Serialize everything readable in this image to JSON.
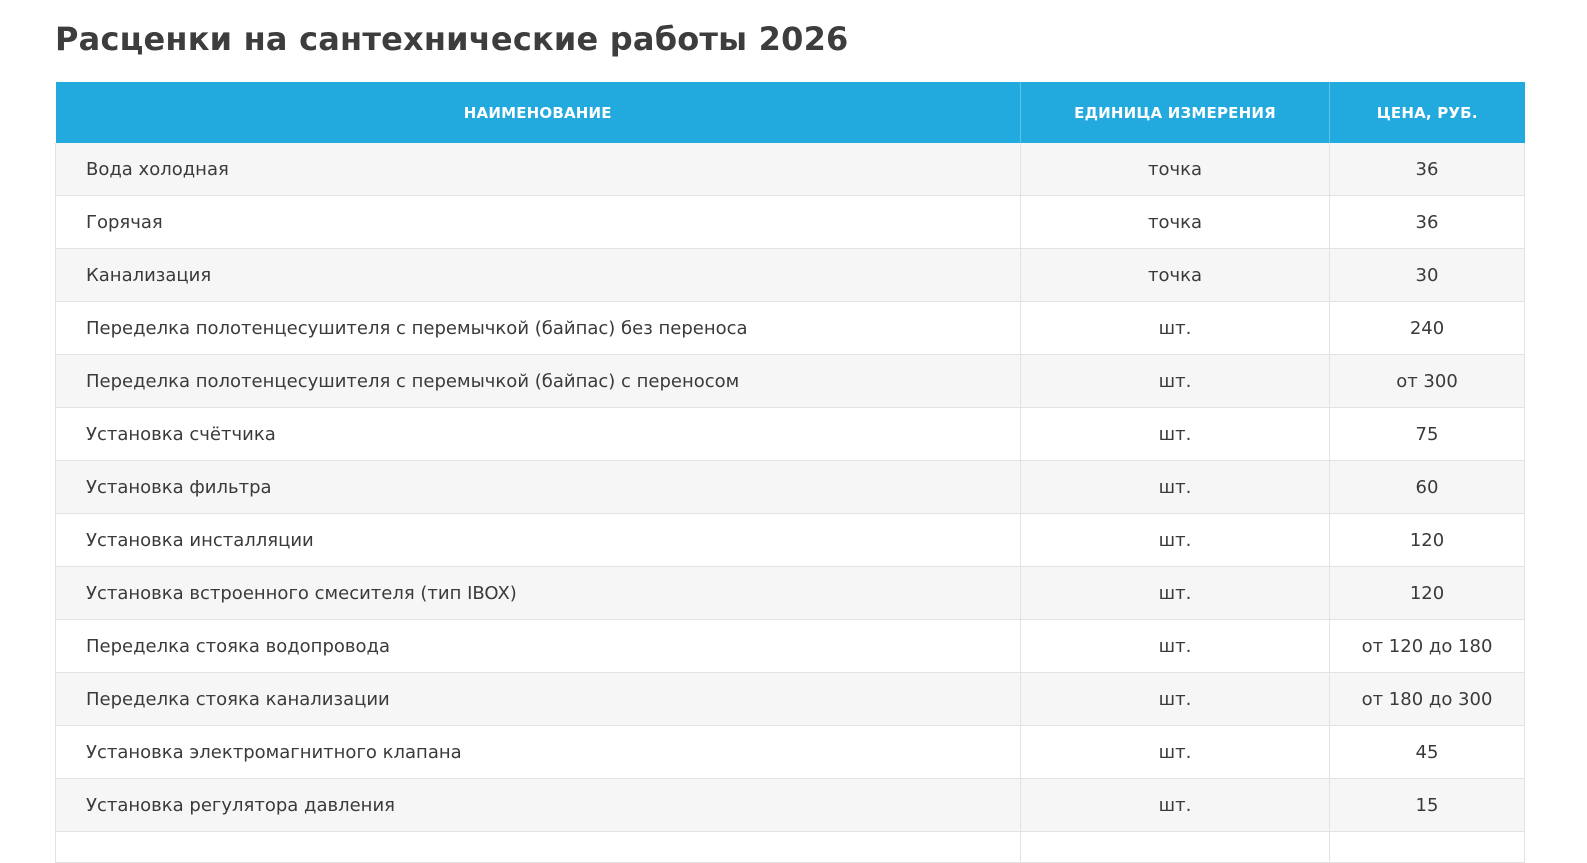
{
  "page": {
    "title": "Расценки на сантехнические работы 2026"
  },
  "table": {
    "headers": {
      "name": "НАИМЕНОВАНИЕ",
      "unit": "ЕДИНИЦА ИЗМЕРЕНИЯ",
      "price": "ЦЕНА, РУБ."
    },
    "rows": [
      {
        "name": "Вода холодная",
        "unit": "точка",
        "price": "36"
      },
      {
        "name": "Горячая",
        "unit": "точка",
        "price": "36"
      },
      {
        "name": "Канализация",
        "unit": "точка",
        "price": "30"
      },
      {
        "name": "Переделка полотенцесушителя с перемычкой (байпас) без переноса",
        "unit": "шт.",
        "price": "240"
      },
      {
        "name": "Переделка полотенцесушителя с перемычкой (байпас) с переносом",
        "unit": "шт.",
        "price": "от 300"
      },
      {
        "name": "Установка счётчика",
        "unit": "шт.",
        "price": "75"
      },
      {
        "name": "Установка фильтра",
        "unit": "шт.",
        "price": "60"
      },
      {
        "name": "Установка инсталляции",
        "unit": "шт.",
        "price": "120"
      },
      {
        "name": "Установка встроенного смесителя (тип IBOX)",
        "unit": "шт.",
        "price": "120"
      },
      {
        "name": "Переделка стояка водопровода",
        "unit": "шт.",
        "price": "от 120 до 180"
      },
      {
        "name": "Переделка стояка канализации",
        "unit": "шт.",
        "price": "от 180 до 300"
      },
      {
        "name": "Установка электромагнитного клапана",
        "unit": "шт.",
        "price": "45"
      },
      {
        "name": "Установка регулятора давления",
        "unit": "шт.",
        "price": "15"
      }
    ]
  }
}
